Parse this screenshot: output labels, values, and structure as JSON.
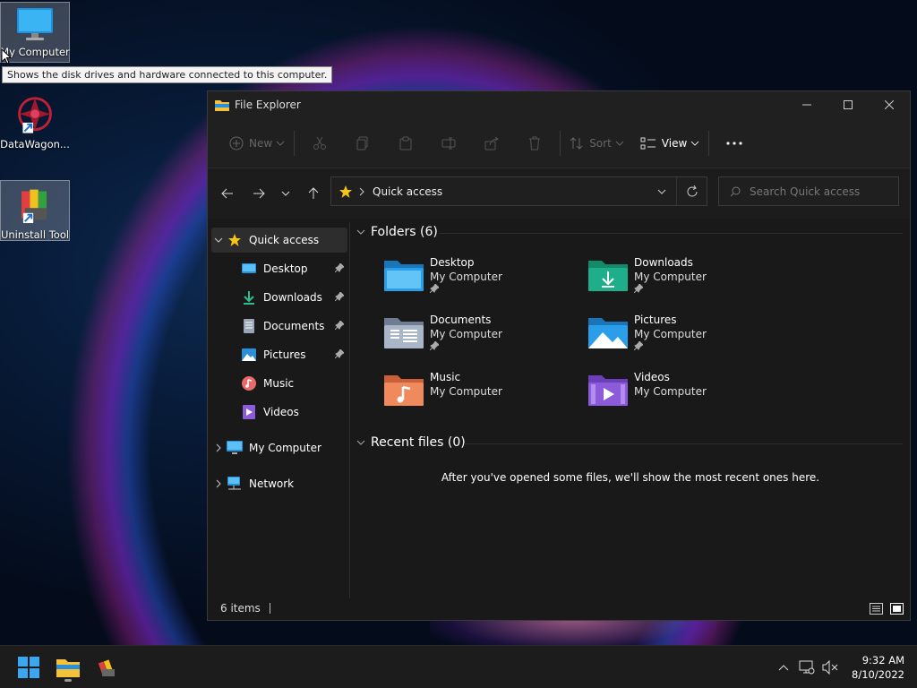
{
  "desktop": {
    "icons": [
      {
        "label": "My Computer"
      },
      {
        "label": "DataWagon..."
      },
      {
        "label": "Uninstall Tool"
      }
    ],
    "tooltip": "Shows the disk drives and hardware connected to this computer."
  },
  "window": {
    "title": "File Explorer",
    "toolbar": {
      "new_label": "New",
      "sort_label": "Sort",
      "view_label": "View"
    },
    "address": {
      "crumb": "Quick access"
    },
    "search": {
      "placeholder": "Search Quick access"
    },
    "sidebar": {
      "quick_access": "Quick access",
      "items": [
        {
          "label": "Desktop"
        },
        {
          "label": "Downloads"
        },
        {
          "label": "Documents"
        },
        {
          "label": "Pictures"
        },
        {
          "label": "Music"
        },
        {
          "label": "Videos"
        }
      ],
      "my_computer": "My Computer",
      "network": "Network"
    },
    "folders": {
      "header": "Folders (6)",
      "items": [
        {
          "name": "Desktop",
          "location": "My Computer"
        },
        {
          "name": "Downloads",
          "location": "My Computer"
        },
        {
          "name": "Documents",
          "location": "My Computer"
        },
        {
          "name": "Pictures",
          "location": "My Computer"
        },
        {
          "name": "Music",
          "location": "My Computer"
        },
        {
          "name": "Videos",
          "location": "My Computer"
        }
      ]
    },
    "recent": {
      "header": "Recent files (0)",
      "empty_message": "After you've opened some files, we'll show the most recent ones here."
    },
    "status": {
      "items_count": "6 items"
    }
  },
  "taskbar": {
    "clock": {
      "time": "9:32 AM",
      "date": "8/10/2022"
    }
  },
  "colors": {
    "folder_blue": "#2a8fd6",
    "folder_green": "#1fae8a",
    "folder_gray": "#8c9bb0",
    "folder_orange": "#f08a5d",
    "folder_purple": "#8b5bd9",
    "quick_access_star": "#f5c518"
  }
}
